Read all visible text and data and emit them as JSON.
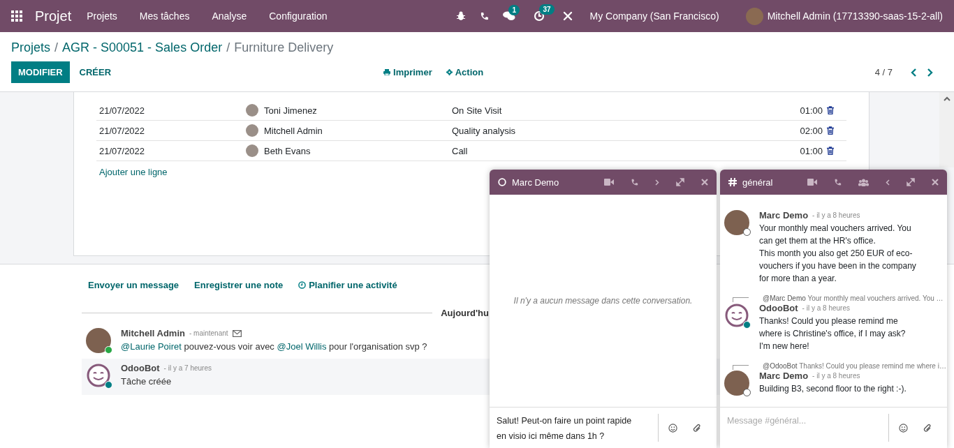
{
  "navbar": {
    "app_name": "Projet",
    "menu": [
      "Projets",
      "Mes tâches",
      "Analyse",
      "Configuration"
    ],
    "messages_badge": "1",
    "activities_badge": "37",
    "company": "My Company (San Francisco)",
    "user": "Mitchell Admin (17713390-saas-15-2-all)"
  },
  "breadcrumb": {
    "links": [
      "Projets",
      "AGR - S00051 - Sales Order"
    ],
    "separator": "/",
    "current": "Furniture Delivery"
  },
  "control_panel": {
    "primary_button": "MODIFIER",
    "secondary_button": "CRÉER",
    "actions": [
      {
        "label": "Imprimer",
        "kind": "print"
      },
      {
        "label": "Action",
        "kind": "gear"
      }
    ],
    "pager": "4 / 7"
  },
  "timesheet": {
    "rows": [
      {
        "date": "21/07/2022",
        "employee": "Toni Jimenez",
        "description": "On Site Visit",
        "hours": "01:00"
      },
      {
        "date": "21/07/2022",
        "employee": "Mitchell Admin",
        "description": "Quality analysis",
        "hours": "02:00"
      },
      {
        "date": "21/07/2022",
        "employee": "Beth Evans",
        "description": "Call",
        "hours": "01:00"
      }
    ],
    "add_line": "Ajouter une ligne"
  },
  "chatter": {
    "actions": [
      {
        "label": "Envoyer un message",
        "kind": "plain"
      },
      {
        "label": "Enregistrer une note",
        "kind": "plain"
      },
      {
        "label": "Planifier une activité",
        "kind": "clock"
      }
    ],
    "date_separator": "Aujourd'hu",
    "messages": [
      {
        "author": "Mitchell Admin",
        "time": "- maintenant",
        "kind": "user",
        "online": true,
        "sent_by_email": true,
        "highlighted": false,
        "body": [
          {
            "text": "@Laurie Poiret",
            "kind": "mention"
          },
          {
            "text": " pouvez-vous voir avec ",
            "kind": "text"
          },
          {
            "text": "@Joel Willis",
            "kind": "mention"
          },
          {
            "text": " pour l'organisation svp ?",
            "kind": "text"
          }
        ]
      },
      {
        "author": "OdooBot",
        "time": "- il y a 7 heures",
        "kind": "bot",
        "online": true,
        "sent_by_email": false,
        "highlighted": true,
        "body": [
          {
            "text": "Tâche créée",
            "kind": "text"
          }
        ]
      }
    ]
  },
  "chat_windows": [
    {
      "title": "Marc Demo",
      "kind": "direct",
      "empty_text": "Il n'y a aucun message dans cette conversation.",
      "composer": {
        "value": "Salut! Peut-on faire un point rapide en visio ici même dans 1h ?"
      }
    },
    {
      "title": "général",
      "kind": "channel",
      "messages": [
        {
          "author": "Marc Demo",
          "time": "- il y a 8 heures",
          "kind": "user",
          "online": false,
          "body": "Your monthly meal vouchers arrived. You can get them at the HR's office.\nThis month you also get 250 EUR of eco-vouchers if you have been in the company for more than a year."
        },
        {
          "author": "OdooBot",
          "time": "- il y a 8 heures",
          "kind": "bot",
          "online": true,
          "reply_to": {
            "author": "@Marc Demo",
            "text": "Your monthly meal vouchers arrived. You …"
          },
          "body": "Thanks! Could you please remind me where is Christine's office, if I may ask? I'm new here!"
        },
        {
          "author": "Marc Demo",
          "time": "- il y a 8 heures",
          "kind": "user",
          "online": false,
          "reply_to": {
            "author": "@OdooBot",
            "text": "Thanks! Could you please remind me where i…"
          },
          "body": "Building B3, second floor to the right :-)."
        }
      ],
      "composer": {
        "placeholder": "Message #général..."
      }
    }
  ]
}
